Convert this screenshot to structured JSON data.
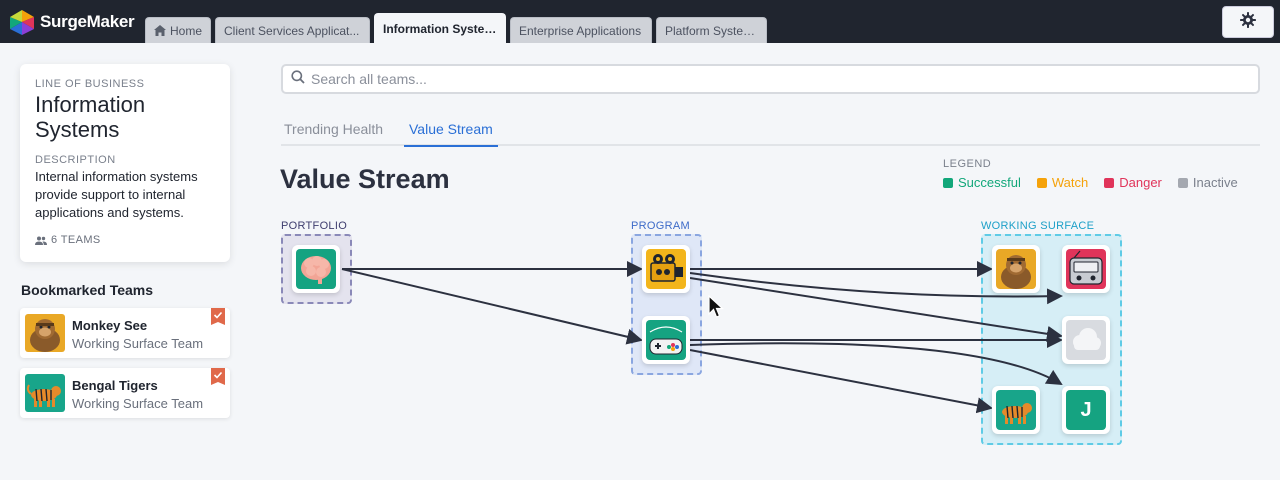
{
  "app": {
    "brand": "SurgeMaker"
  },
  "tabs": [
    {
      "label": "Home",
      "icon": "home-icon"
    },
    {
      "label": "Client Services Applicat..."
    },
    {
      "label": "Information Systems",
      "active": true
    },
    {
      "label": "Enterprise Applications"
    },
    {
      "label": "Platform Systems"
    }
  ],
  "settings": {
    "icon": "gear-icon"
  },
  "lob": {
    "caption": "LINE OF BUSINESS",
    "title": "Information Systems",
    "desc_label": "DESCRIPTION",
    "description": "Internal information systems provide support to internal applications and systems.",
    "teams": "6 TEAMS"
  },
  "bookmarks": {
    "title": "Bookmarked Teams",
    "items": [
      {
        "name": "Monkey See",
        "sub": "Working Surface Team"
      },
      {
        "name": "Bengal Tigers",
        "sub": "Working Surface Team"
      }
    ]
  },
  "search": {
    "placeholder": "Search all teams...",
    "value": ""
  },
  "view_tabs": [
    {
      "label": "Trending Health"
    },
    {
      "label": "Value Stream",
      "active": true
    }
  ],
  "value_stream": {
    "title": "Value Stream",
    "legend_caption": "LEGEND",
    "legend": [
      {
        "label": "Successful",
        "color": "#12a77a"
      },
      {
        "label": "Watch",
        "color": "#f5a20a"
      },
      {
        "label": "Danger",
        "color": "#e0345a"
      },
      {
        "label": "Inactive",
        "color": "#a4a8b0"
      }
    ],
    "groups": {
      "portfolio": "PORTFOLIO",
      "program": "PROGRAM",
      "working_surface": "WORKING SURFACE"
    },
    "working_surface_letter": "J"
  },
  "colors": {
    "accent": "#2a6fd6",
    "portfolio_group": "#6b6a9b",
    "program_group": "#6f8fd8",
    "working_group": "#38b8d8"
  }
}
